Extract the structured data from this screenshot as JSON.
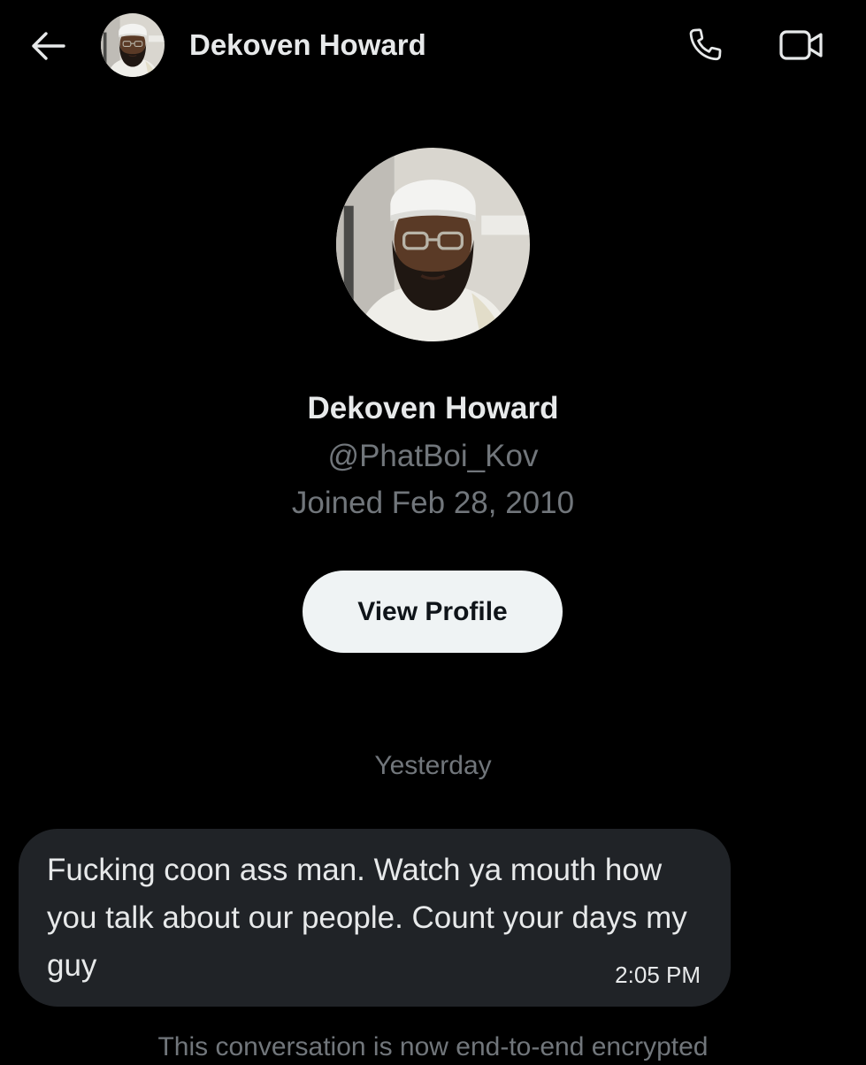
{
  "header": {
    "contact_name": "Dekoven Howard",
    "back_icon": "arrow-left-icon",
    "call_icon": "phone-icon",
    "video_icon": "video-camera-icon"
  },
  "profile": {
    "name": "Dekoven Howard",
    "handle": "@PhatBoi_Kov",
    "joined": "Joined Feb 28, 2010",
    "view_profile_label": "View Profile"
  },
  "conversation": {
    "date_divider": "Yesterday",
    "messages": [
      {
        "text": "Fucking coon ass man. Watch ya mouth how you talk about our people. Count your days my guy",
        "time": "2:05 PM"
      }
    ],
    "encryption_notice": "This conversation is now end-to-end encrypted"
  },
  "colors": {
    "background": "#000000",
    "primary_text": "#e7e9ea",
    "secondary_text": "#71767b",
    "bubble": "#202327",
    "button_bg": "#eff3f4",
    "button_text": "#0f1419"
  }
}
